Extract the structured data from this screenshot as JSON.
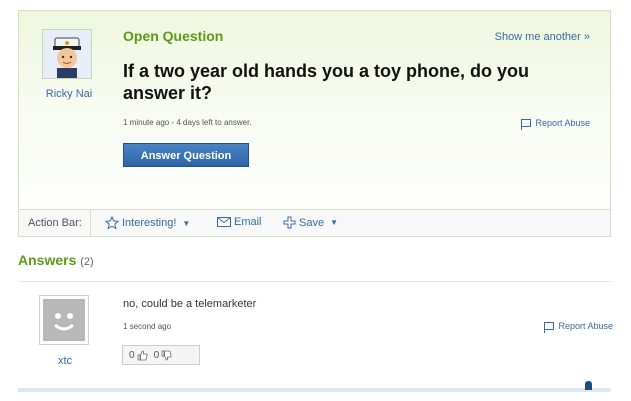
{
  "question": {
    "asker_name": "Ricky Nai",
    "type_label": "Open Question",
    "show_another": "Show me another »",
    "title": "If a two year old hands you a toy phone, do you answer it?",
    "meta": "1 minute ago - 4 days left to answer.",
    "report_label": "Report Abuse",
    "answer_button": "Answer Question"
  },
  "action_bar": {
    "label": "Action Bar:",
    "interesting": "Interesting!",
    "email": "Email",
    "save": "Save"
  },
  "answers": {
    "heading": "Answers",
    "count": "(2)",
    "items": [
      {
        "user": "xtc",
        "text": "no, could be a telemarketer",
        "time": "1 second ago",
        "report_label": "Report Abuse",
        "thumbs_up": "0",
        "thumbs_down": "0"
      }
    ]
  },
  "colors": {
    "accent_green": "#5b9b18",
    "link_blue": "#3a68a8",
    "button_blue": "#2d64a6"
  },
  "icons": {
    "star": "star-icon",
    "email": "envelope-icon",
    "save": "plus-icon",
    "flag": "flag-icon",
    "thumbs_up": "thumbs-up-icon",
    "thumbs_down": "thumbs-down-icon"
  }
}
